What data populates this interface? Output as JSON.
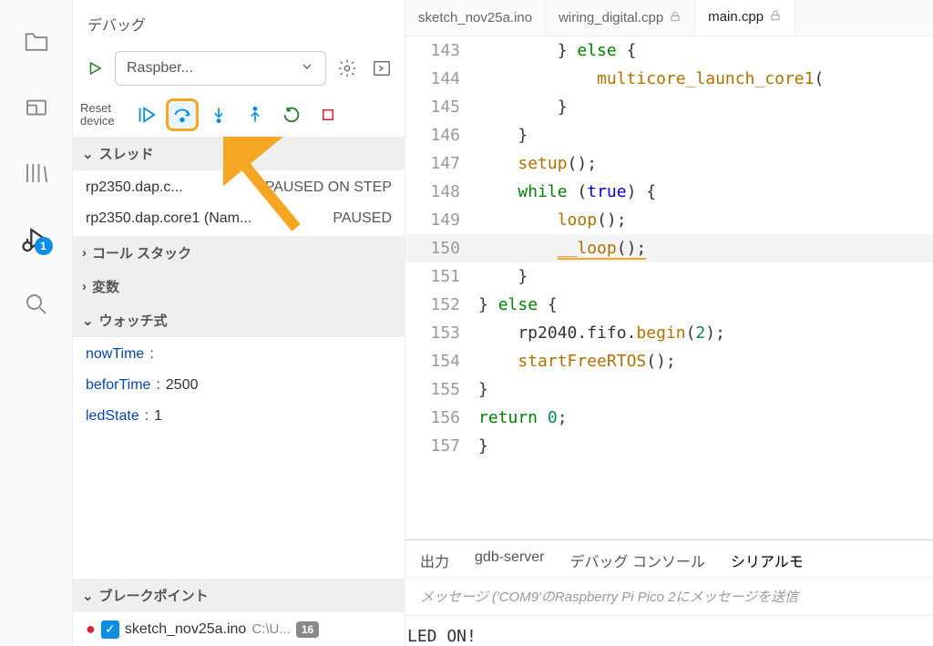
{
  "panel_title": "デバッグ",
  "debug_badge": "1",
  "config_selected": "Raspber...",
  "reset_device": "Reset device",
  "sections": {
    "threads": "スレッド",
    "callstack": "コール スタック",
    "variables": "変数",
    "watch": "ウォッチ式",
    "breakpoints": "ブレークポイント"
  },
  "threads": [
    {
      "name": "rp2350.dap.c...",
      "status": "PAUSED ON STEP"
    },
    {
      "name": "rp2350.dap.core1 (Nam...",
      "status": "PAUSED"
    }
  ],
  "watch": [
    {
      "name": "nowTime",
      "value": ""
    },
    {
      "name": "beforTime",
      "value": "2500"
    },
    {
      "name": "ledState",
      "value": "1"
    }
  ],
  "breakpoint": {
    "file": "sketch_nov25a.ino",
    "path": "C:\\U...",
    "count": "16"
  },
  "tabs": [
    {
      "label": "sketch_nov25a.ino",
      "locked": false,
      "active": false
    },
    {
      "label": "wiring_digital.cpp",
      "locked": true,
      "active": false
    },
    {
      "label": "main.cpp",
      "locked": true,
      "active": true
    }
  ],
  "code_lines": [
    {
      "n": "143",
      "text": "        } else {"
    },
    {
      "n": "144",
      "text": "            multicore_launch_core1("
    },
    {
      "n": "145",
      "text": "        }"
    },
    {
      "n": "146",
      "text": "    }"
    },
    {
      "n": "147",
      "text": "    setup();"
    },
    {
      "n": "148",
      "text": "    while (true) {"
    },
    {
      "n": "149",
      "text": "        loop();"
    },
    {
      "n": "150",
      "text": "        __loop();"
    },
    {
      "n": "151",
      "text": "    }"
    },
    {
      "n": "152",
      "text": "} else {"
    },
    {
      "n": "153",
      "text": "    rp2040.fifo.begin(2);"
    },
    {
      "n": "154",
      "text": "    startFreeRTOS();"
    },
    {
      "n": "155",
      "text": "}"
    },
    {
      "n": "156",
      "text": "return 0;"
    },
    {
      "n": "157",
      "text": "}"
    }
  ],
  "bottom_tabs": [
    "出力",
    "gdb-server",
    "デバッグ コンソール",
    "シリアルモ"
  ],
  "msg_placeholder": "メッセージ  ('COM9'のRaspberry Pi Pico 2にメッセージを送信",
  "terminal_out": "LED ON!"
}
